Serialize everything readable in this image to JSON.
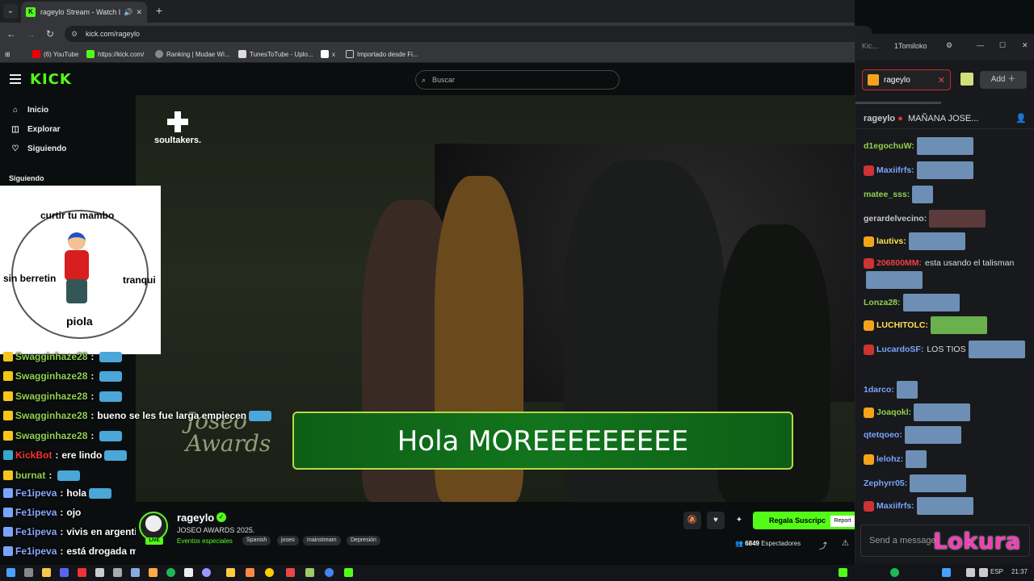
{
  "browser": {
    "tab_title": "rageylo Stream - Watch Liv",
    "url": "kick.com/rageylo",
    "bookmarks": [
      "(6) YouTube",
      "https://kick.com/",
      "Ranking | Mudae Wi...",
      "TunesToTube - Uplo...",
      "x",
      "Importado desde Fi..."
    ]
  },
  "header": {
    "logo": "KICK",
    "search_placeholder": "Buscar"
  },
  "sidebar": {
    "items": [
      {
        "label": "Inicio",
        "icon": "home-icon"
      },
      {
        "label": "Explorar",
        "icon": "compass-icon"
      },
      {
        "label": "Siguiendo",
        "icon": "heart-icon"
      }
    ],
    "following_title": "Siguiendo"
  },
  "meme": {
    "top": "curtir tu mambo",
    "left": "sin berretin",
    "right": "tranqui",
    "bottom": "piola"
  },
  "video": {
    "brand": "soultakers.",
    "lower_third": "Hola MOREEEEEEEEE",
    "event_logo": "Joseo\nAwards"
  },
  "overlay_chat": [
    {
      "user": "Swagginhaze28",
      "text": "",
      "emote": true
    },
    {
      "user": "Swagginhaze28",
      "text": "",
      "emote": true
    },
    {
      "user": "Swagginhaze28",
      "text": "",
      "emote": true
    },
    {
      "user": "Swagginhaze28",
      "text": "bueno se les fue larga empiecen",
      "emote": true
    },
    {
      "user": "Swagginhaze28",
      "text": "",
      "emote": true
    },
    {
      "user": "KickBot",
      "text": "ere lindo",
      "emote": true
    },
    {
      "user": "burnat",
      "text": "",
      "emote": true
    },
    {
      "user": "Fe1ipeva",
      "text": "hola",
      "emote": true
    },
    {
      "user": "Fe1ipeva",
      "text": "ojo",
      "emote": false
    },
    {
      "user": "Fe1ipeva",
      "text": "vivis en argentina bro?",
      "emote": false
    },
    {
      "user": "Fe1ipeva",
      "text": "está drogada mepa",
      "emote": false
    }
  ],
  "stream": {
    "streamer": "rageylo",
    "title": "JOSEO AWARDS 2025.",
    "category": "Eventos especiales",
    "tags": [
      "Spanish",
      "joseo",
      "mainstream",
      "Depresión"
    ],
    "live_label": "LIVE",
    "subscribe_label": "Regala Suscripc",
    "report_label": "Report",
    "viewers_count": "6849",
    "viewers_label": "Espectadores"
  },
  "chat": {
    "window_title": "Kic...",
    "account": "1Tomiloko",
    "tab_name": "rageylo",
    "add_label": "Add",
    "pinned_user": "rageylo",
    "pinned_text": "MAÑANA JOSE...",
    "messages": [
      {
        "user": "d1egochuW:",
        "text": "",
        "color": "#8fd14f"
      },
      {
        "user": "Maxiifrfs:",
        "text": "",
        "color": "#7aa4ff"
      },
      {
        "user": "matee_sss:",
        "text": "",
        "color": "#8fd14f"
      },
      {
        "user": "gerardelvecino:",
        "text": "",
        "color": "#c6c6c6"
      },
      {
        "user": "lautivs:",
        "text": "",
        "color": "#ffe24a"
      },
      {
        "user": "206800MM:",
        "text": "esta usando el talisman",
        "color": "#f23f3f"
      },
      {
        "user": "Lonza28:",
        "text": "",
        "color": "#8fd14f"
      },
      {
        "user": "LUCHITOLC:",
        "text": "",
        "color": "#ffe24a"
      },
      {
        "user": "LucardoSF:",
        "text": "LOS TIOS",
        "color": "#7aa4ff"
      },
      {
        "user": "1darco:",
        "text": "",
        "color": "#7aa4ff"
      },
      {
        "user": "Joaqokl:",
        "text": "",
        "color": "#8fd14f"
      },
      {
        "user": "qtetqoeo:",
        "text": "",
        "color": "#7aa4ff"
      },
      {
        "user": "lelohz:",
        "text": "",
        "color": "#7aa4ff"
      },
      {
        "user": "Zephyrr05:",
        "text": "",
        "color": "#7aa4ff"
      },
      {
        "user": "Maxiifrfs:",
        "text": "",
        "color": "#7aa4ff"
      }
    ],
    "input_placeholder": "Send a message",
    "overlay_text": "Lokura"
  },
  "taskbar": {
    "lang": "ESP",
    "time": "21:37"
  },
  "colors": {
    "kick_green": "#53fc18",
    "background": "#0b0e0f",
    "chat_bg": "#18191c"
  }
}
